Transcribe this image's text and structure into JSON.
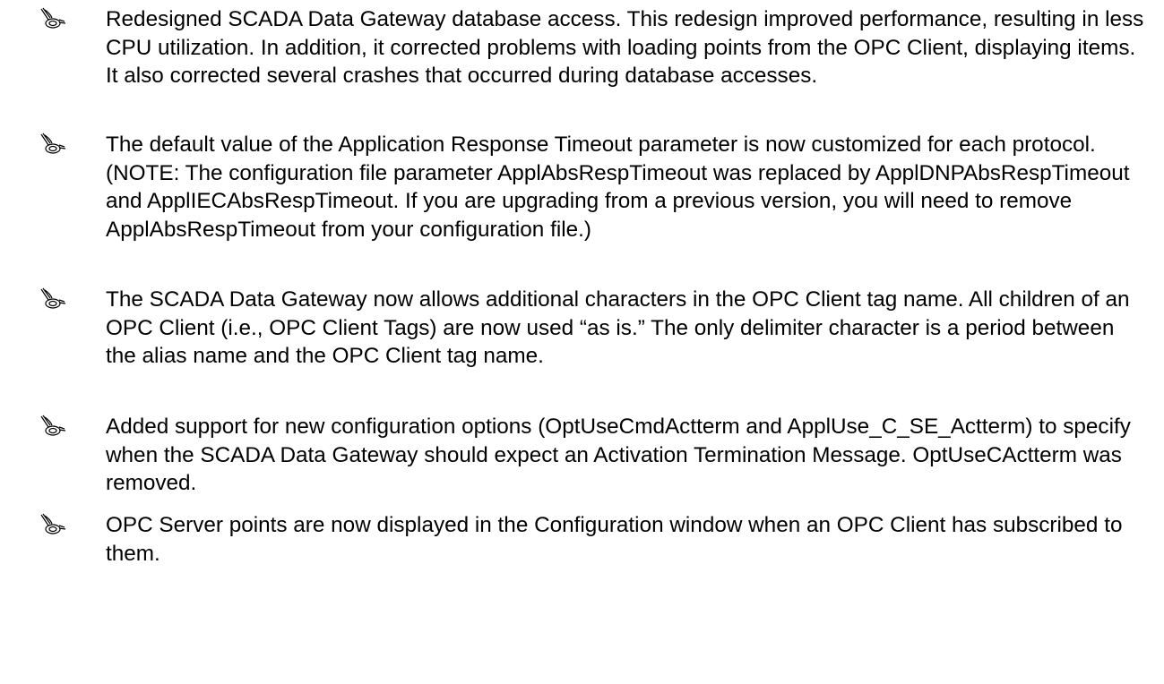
{
  "bullets": [
    {
      "icon": "note-icon",
      "text": "Redesigned SCADA Data Gateway database access. This redesign improved performance, resulting in less CPU utilization. In addition, it corrected problems with loading points from the OPC Client, displaying items. It also corrected several crashes that occurred during database accesses."
    },
    {
      "icon": "note-icon",
      "text": "The default value of the Application Response Timeout parameter is now customized for each protocol. (NOTE: The configuration file parameter ApplAbsRespTimeout was replaced by ApplDNPAbsRespTimeout and ApplIECAbsRespTimeout. If you are upgrading from a previous version, you will need to remove ApplAbsRespTimeout from your configuration file.)"
    },
    {
      "icon": "note-icon",
      "text": "The SCADA Data Gateway now allows additional characters in the OPC Client tag name. All children of an OPC Client (i.e., OPC Client Tags) are now used “as is.” The only delimiter character is a period between the alias name and the OPC Client tag name."
    },
    {
      "icon": "note-icon",
      "text": "Added support for new configuration options (OptUseCmdActterm and ApplUse_C_SE_Actterm) to specify when the SCADA Data Gateway should expect an Activation Termination Message. OptUseCActterm was removed."
    },
    {
      "icon": "note-icon",
      "text": "OPC Server points are now displayed in the Configuration window when an OPC Client has subscribed to them."
    }
  ]
}
